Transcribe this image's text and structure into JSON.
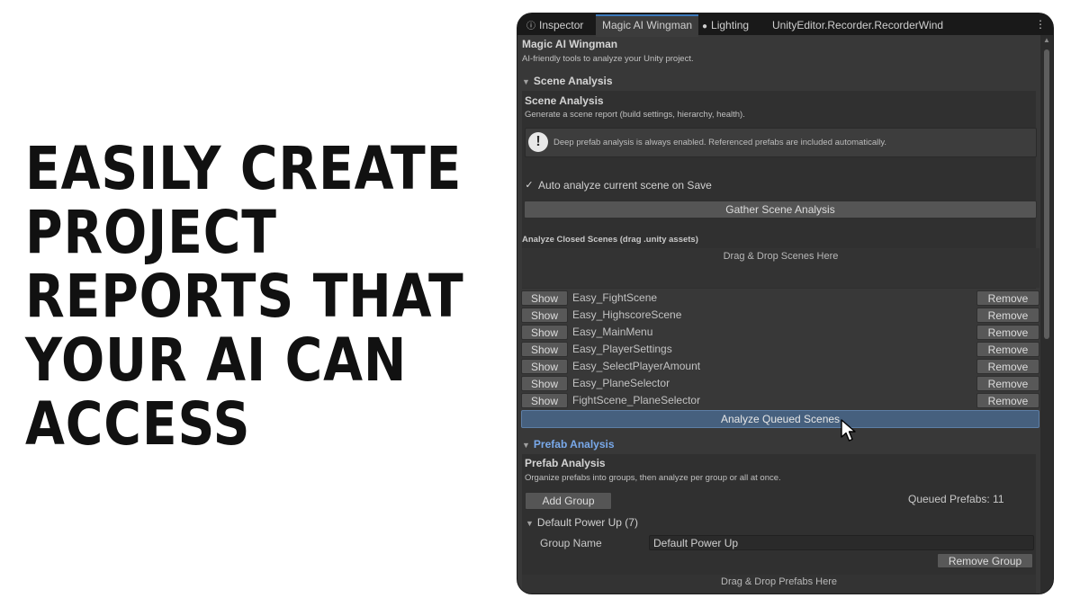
{
  "headline": [
    "EASILY CREATE",
    "PROJECT",
    "REPORTS THAT",
    "YOUR AI CAN",
    "ACCESS"
  ],
  "tabs": [
    {
      "label": "Inspector",
      "icon": "info-icon"
    },
    {
      "label": "Magic AI Wingman",
      "icon": ""
    },
    {
      "label": "Lighting",
      "icon": "lightbulb-icon"
    },
    {
      "label": "UnityEditor.Recorder.RecorderWind",
      "icon": ""
    }
  ],
  "window": {
    "title": "Magic AI Wingman",
    "subtitle": "AI-friendly tools to analyze your Unity project."
  },
  "scene_analysis": {
    "foldout_label": "Scene Analysis",
    "title": "Scene Analysis",
    "description": "Generate a scene report (build settings, hierarchy, health).",
    "help_text": "Deep prefab analysis is always enabled. Referenced prefabs are included automatically.",
    "auto_analyze_label": "Auto analyze current scene on Save",
    "auto_analyze_checked": true,
    "gather_button": "Gather Scene Analysis",
    "closed_scenes_label": "Analyze Closed Scenes (drag .unity assets)",
    "drop_zone": "Drag & Drop Scenes Here",
    "show_label": "Show",
    "remove_label": "Remove",
    "scenes": [
      "Easy_FightScene",
      "Easy_HighscoreScene",
      "Easy_MainMenu",
      "Easy_PlayerSettings",
      "Easy_SelectPlayerAmount",
      "Easy_PlaneSelector",
      "FightScene_PlaneSelector"
    ],
    "analyze_button": "Analyze Queued Scenes"
  },
  "prefab_analysis": {
    "foldout_label": "Prefab Analysis",
    "title": "Prefab Analysis",
    "description": "Organize prefabs into groups, then analyze per group or all at once.",
    "add_group_button": "Add Group",
    "queued_prefabs": "Queued Prefabs: 11",
    "group_foldout": "Default Power Up (7)",
    "group_name_label": "Group Name",
    "group_name_value": "Default Power Up",
    "remove_group_button": "Remove Group",
    "drop_zone": "Drag & Drop Prefabs Here"
  },
  "colors": {
    "panel": "#383838",
    "tabbar": "#191919",
    "accent_blue": "#79a9ea",
    "primary_button": "#46607e"
  }
}
